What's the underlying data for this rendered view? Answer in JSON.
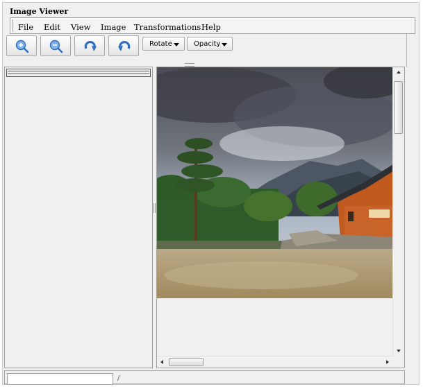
{
  "window": {
    "title": "Image Viewer"
  },
  "menu": [
    "File",
    "Edit",
    "View",
    "Image",
    "Transformations",
    "Help"
  ],
  "toolbar": {
    "zoom_in_icon": "zoom-in-icon",
    "zoom_out_icon": "zoom-out-icon",
    "rotate_cw_icon": "rotate-clockwise-icon",
    "rotate_ccw_icon": "rotate-counterclockwise-icon",
    "rotate_label": "Rotate",
    "opacity_label": "Opacity"
  },
  "statusbar": {
    "field_value": "",
    "separator": "/"
  },
  "colors": {
    "window_bg": "#f0f0f0",
    "border": "#a0a0a0",
    "icon_blue": "#3b78c4"
  }
}
